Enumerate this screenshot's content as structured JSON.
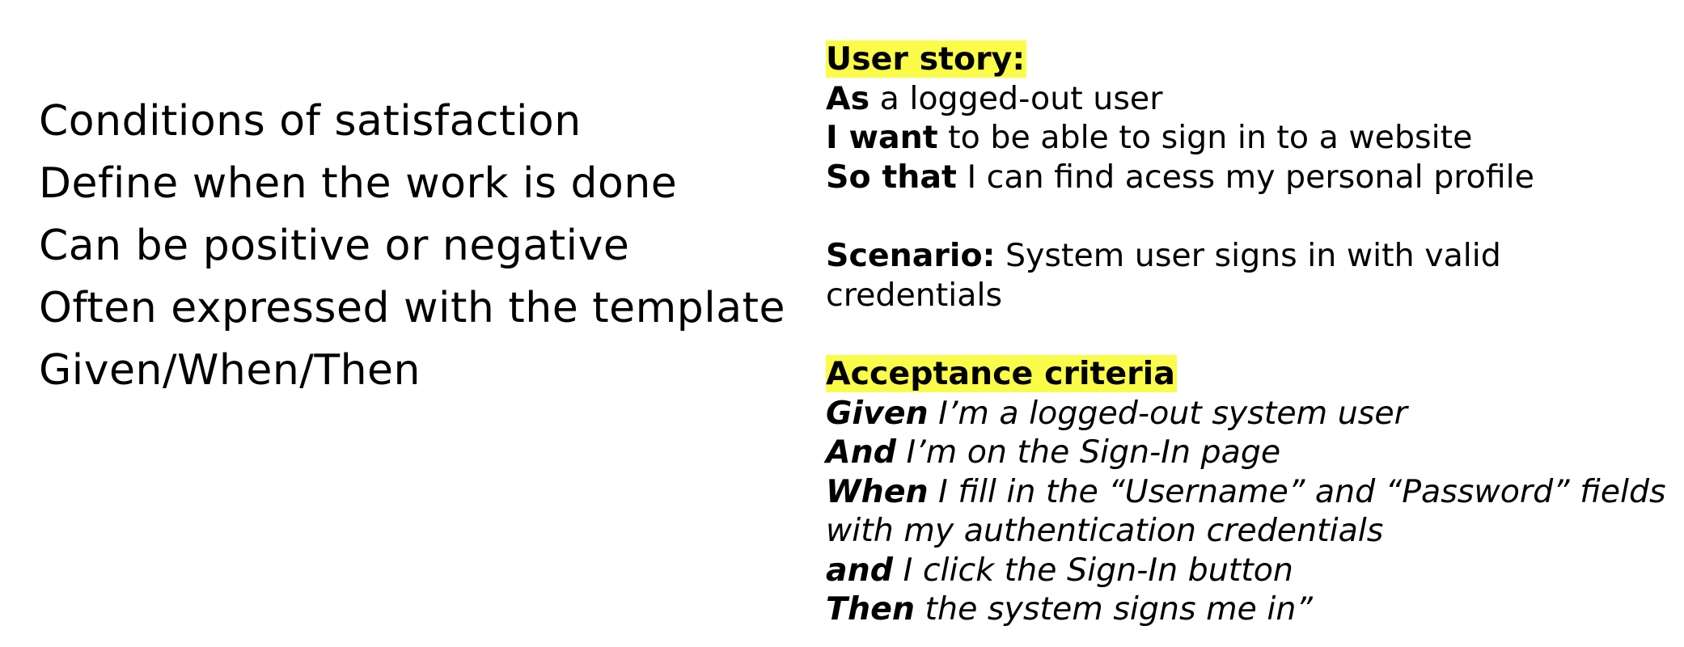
{
  "left_points": [
    "Conditions of satisfaction",
    "Define when the work is done",
    "Can be positive or negative",
    "Often expressed with the template",
    "Given/When/Then"
  ],
  "user_story": {
    "heading": "User story:",
    "lines": [
      {
        "keyword": "As",
        "text": " a logged-out user"
      },
      {
        "keyword": "I want",
        "text": " to be able to sign in to a website"
      },
      {
        "keyword": "So that",
        "text": " I can find acess my personal profile"
      }
    ]
  },
  "scenario": {
    "keyword": "Scenario:",
    "text": " System user signs in with valid",
    "text_cont": "credentials"
  },
  "acceptance": {
    "heading": "Acceptance criteria",
    "lines": [
      {
        "keyword": "Given",
        "text": " I’m a logged-out system user"
      },
      {
        "keyword": "And",
        "text": " I’m on the Sign-In page"
      },
      {
        "keyword": "When",
        "text": " I fill in the “Username” and “Password” fields"
      },
      {
        "keyword": "",
        "text": "with my authentication credentials"
      },
      {
        "keyword": "and",
        "text": " I click the Sign-In button"
      },
      {
        "keyword": "Then",
        "text": " the system signs me in”"
      }
    ]
  },
  "colors": {
    "highlight": "#fbfb4a",
    "text": "#000000",
    "background": "#ffffff"
  }
}
